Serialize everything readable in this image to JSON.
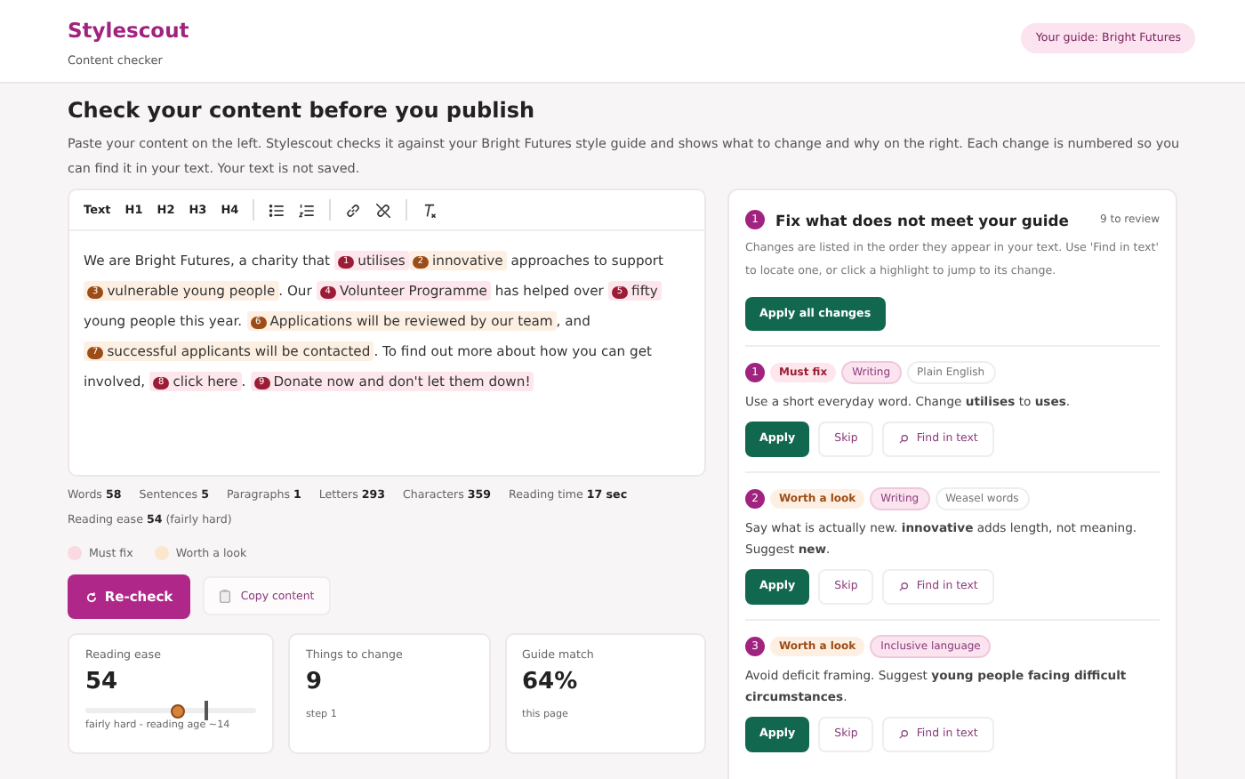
{
  "header": {
    "brand": "Stylescout",
    "subtitle": "Content checker",
    "guide_badge": "Your guide: Bright Futures"
  },
  "title": "Check your content before you publish",
  "intro": "Paste your content on the left. Stylescout checks it against your Bright Futures style guide and shows what to change and why on the right. Each change is numbered so you can find it in your text. Your text is not saved.",
  "toolbar": [
    {
      "kind": "label",
      "text": "Text"
    },
    {
      "kind": "label",
      "text": "H1"
    },
    {
      "kind": "label",
      "text": "H2"
    },
    {
      "kind": "label",
      "text": "H3"
    },
    {
      "kind": "label",
      "text": "H4"
    },
    {
      "kind": "sep"
    },
    {
      "kind": "bullets"
    },
    {
      "kind": "numbers"
    },
    {
      "kind": "sep"
    },
    {
      "kind": "link"
    },
    {
      "kind": "unlink"
    },
    {
      "kind": "sep"
    },
    {
      "kind": "clear"
    }
  ],
  "editor": [
    {
      "kind": "text",
      "text": "We are Bright Futures, a charity that "
    },
    {
      "kind": "must",
      "number": "1",
      "text": "utilises"
    },
    {
      "kind": "look",
      "number": "2",
      "text": "innovative"
    },
    {
      "kind": "text",
      "text": " approaches to support "
    },
    {
      "kind": "look",
      "number": "3",
      "text": "vulnerable young people"
    },
    {
      "kind": "text",
      "text": ". Our "
    },
    {
      "kind": "must",
      "number": "4",
      "text": "Volunteer Programme"
    },
    {
      "kind": "text",
      "text": " has helped over "
    },
    {
      "kind": "must",
      "number": "5",
      "text": "fifty"
    },
    {
      "kind": "text",
      "text": " young people this year. "
    },
    {
      "kind": "look",
      "number": "6",
      "text": "Applications will be reviewed by our team"
    },
    {
      "kind": "text",
      "text": ", and "
    },
    {
      "kind": "look",
      "number": "7",
      "text": "successful applicants will be contacted"
    },
    {
      "kind": "text",
      "text": ". To find out more about how you can get "
    },
    {
      "kind": "text",
      "text": "involved, "
    },
    {
      "kind": "must",
      "number": "8",
      "text": "click here"
    },
    {
      "kind": "text",
      "text": ". "
    },
    {
      "kind": "must",
      "number": "9",
      "text": "Donate now and don't let them down!"
    }
  ],
  "stats": [
    {
      "label": "Words",
      "value": "58"
    },
    {
      "label": "Sentences",
      "value": "5"
    },
    {
      "label": "Paragraphs",
      "value": "1"
    },
    {
      "label": "Letters",
      "value": "293"
    },
    {
      "label": "Characters",
      "value": "359"
    },
    {
      "label": "Reading time",
      "value": "17 sec"
    }
  ],
  "reading_ease_line": {
    "label": "Reading ease",
    "value": "54",
    "note": "(fairly hard)"
  },
  "legend": [
    {
      "kind": "must",
      "label": "Must fix"
    },
    {
      "kind": "look",
      "label": "Worth a look"
    }
  ],
  "recheck_button": "Re-check",
  "copy_button": "Copy content",
  "cards": [
    {
      "kind": "slider",
      "label": "Reading ease",
      "value": "54",
      "level": 0.54,
      "target": {
        "level": 0.7
      },
      "caption": "fairly hard - reading age ~14"
    },
    {
      "kind": "plain",
      "label": "Things to change",
      "value": "9",
      "caption": "step 1"
    },
    {
      "kind": "plain",
      "label": "Guide match",
      "value": "64%",
      "caption": "this page"
    }
  ],
  "panel": {
    "step": "1",
    "title": "Fix what does not meet your guide",
    "count": "9 to review",
    "description": "Changes are listed in the order they appear in your text. Use 'Find in text' to locate one, or click a highlight to jump to its change.",
    "apply_all": "Apply all changes",
    "issues": [
      {
        "number": "1",
        "kind": "must",
        "severity_label": "Must fix",
        "tags": [
          {
            "kind": "category",
            "text": "Writing"
          },
          {
            "kind": "rule",
            "text": "Plain English"
          }
        ],
        "text": "Use a short everyday word. Change **utilises** to **uses**.",
        "buttons": [
          "Apply",
          "Skip",
          "Find in text"
        ]
      },
      {
        "number": "2",
        "kind": "look",
        "severity_label": "Worth a look",
        "tags": [
          {
            "kind": "category",
            "text": "Writing"
          },
          {
            "kind": "rule",
            "text": "Weasel words"
          }
        ],
        "text": "Say what is actually new. **innovative** adds length, not meaning. Suggest **new**.",
        "buttons": [
          "Apply",
          "Skip",
          "Find in text"
        ]
      },
      {
        "number": "3",
        "kind": "look",
        "severity_label": "Worth a look",
        "tags": [
          {
            "kind": "category",
            "text": "Inclusive language"
          }
        ],
        "text": "Avoid deficit framing. Suggest **young people facing difficult circumstances**.",
        "buttons": [
          "Apply",
          "Skip",
          "Find in text"
        ]
      }
    ]
  }
}
